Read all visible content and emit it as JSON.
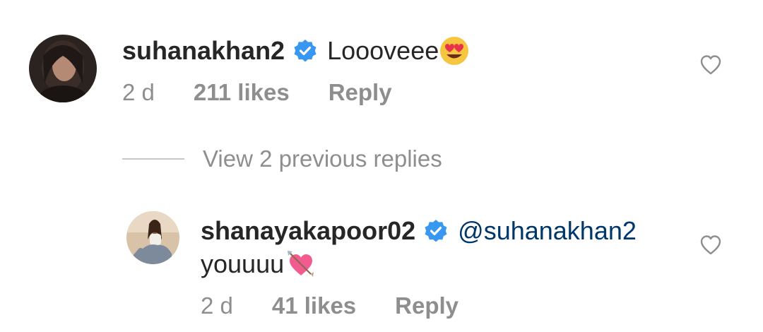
{
  "comment": {
    "username": "suhanakhan2",
    "text": "Loooveee",
    "emoji_icon": "heart-eyes-emoji",
    "time": "2 d",
    "likes": "211 likes",
    "reply_label": "Reply",
    "verified": true
  },
  "view_replies": {
    "label": "View 2 previous replies"
  },
  "reply": {
    "username": "shanayakapoor02",
    "mention": "@suhanakhan2",
    "text": "youuuu",
    "emoji_icon": "heart-with-arrow-emoji",
    "time": "2 d",
    "likes": "41 likes",
    "reply_label": "Reply",
    "verified": true
  },
  "colors": {
    "text": "#262626",
    "secondary": "#8e8e8e",
    "mention": "#00376b",
    "verified_badge": "#3897f0"
  }
}
